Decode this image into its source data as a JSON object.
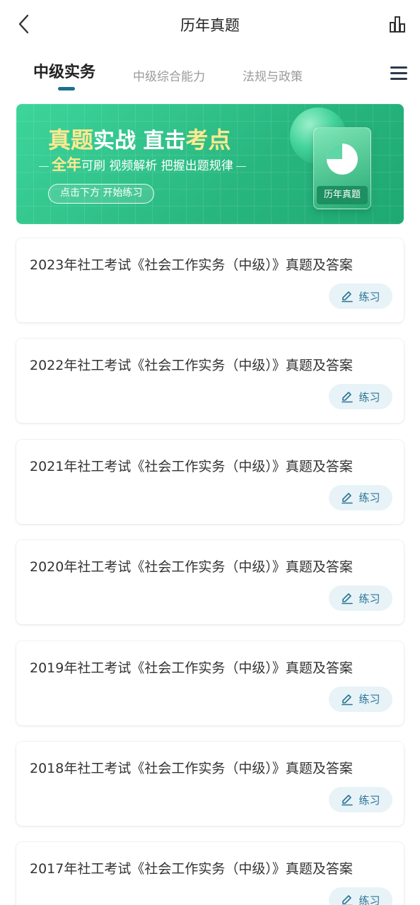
{
  "header": {
    "title": "历年真题"
  },
  "tabs": [
    {
      "label": "中级实务",
      "active": true
    },
    {
      "label": "中级综合能力",
      "active": false
    },
    {
      "label": "法规与政策",
      "active": false
    }
  ],
  "banner": {
    "headline_parts": [
      "真题",
      "实战 直击",
      "考点"
    ],
    "subline_parts": [
      "全年",
      "可刷 视频解析 把握出题规律"
    ],
    "button_label": "点击下方 开始练习",
    "book_label": "历年真题"
  },
  "practice_label": "练习",
  "items": [
    {
      "title": "2023年社工考试《社会工作实务（中级）》真题及答案"
    },
    {
      "title": "2022年社工考试《社会工作实务（中级）》真题及答案"
    },
    {
      "title": "2021年社工考试《社会工作实务（中级）》真题及答案"
    },
    {
      "title": "2020年社工考试《社会工作实务（中级）》真题及答案"
    },
    {
      "title": "2019年社工考试《社会工作实务（中级）》真题及答案"
    },
    {
      "title": "2018年社工考试《社会工作实务（中级）》真题及答案"
    },
    {
      "title": "2017年社工考试《社会工作实务（中级）》真题及答案"
    }
  ],
  "colors": {
    "accent": "#1d6f8e",
    "banner_green": "#2fc28a",
    "highlight_yellow": "#ffe98f",
    "practice_bg": "#e7f3f7"
  }
}
